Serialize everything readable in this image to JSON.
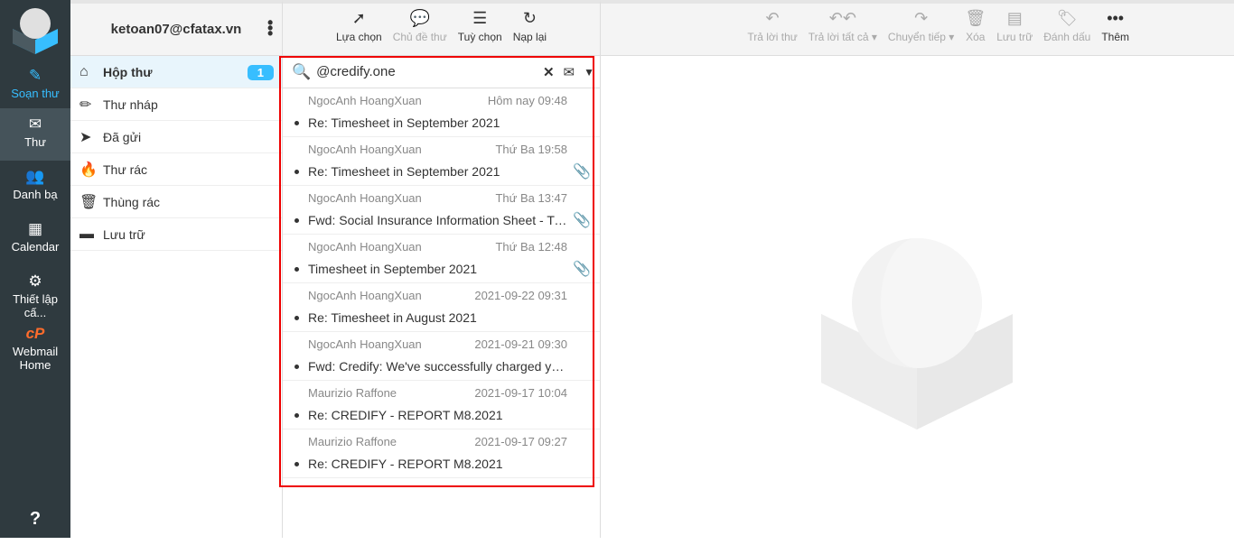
{
  "rail": {
    "items": [
      {
        "label": "Soạn thư",
        "icon": "compose-icon"
      },
      {
        "label": "Thư",
        "icon": "envelope-icon"
      },
      {
        "label": "Danh bạ",
        "icon": "contacts-icon"
      },
      {
        "label": "Calendar",
        "icon": "calendar-icon"
      },
      {
        "label": "Thiết lập cấ...",
        "icon": "gear-icon"
      },
      {
        "label": "Webmail Home",
        "icon": "cpanel-icon"
      }
    ],
    "help_icon": "help-icon"
  },
  "account": "ketoan07@cfatax.vn",
  "folders": [
    {
      "label": "Hộp thư",
      "count": "1"
    },
    {
      "label": "Thư nháp"
    },
    {
      "label": "Đã gửi"
    },
    {
      "label": "Thư rác"
    },
    {
      "label": "Thùng rác"
    },
    {
      "label": "Lưu trữ"
    }
  ],
  "list_toolbar": {
    "select": "Lựa chọn",
    "threads": "Chủ đề thư",
    "options": "Tuỳ chọn",
    "refresh": "Nạp lại"
  },
  "search": {
    "value": "@credify.one"
  },
  "messages": [
    {
      "from": "NgocAnh HoangXuan",
      "date": "Hôm nay 09:48",
      "subject": "Re: Timesheet in September 2021",
      "attachment": false
    },
    {
      "from": "NgocAnh HoangXuan",
      "date": "Thứ Ba 19:58",
      "subject": "Re: Timesheet in September 2021",
      "attachment": true
    },
    {
      "from": "NgocAnh HoangXuan",
      "date": "Thứ Ba 13:47",
      "subject": "Fwd: Social Insurance Information Sheet - Tran Thi",
      "attachment": true
    },
    {
      "from": "NgocAnh HoangXuan",
      "date": "Thứ Ba 12:48",
      "subject": "Timesheet in September 2021",
      "attachment": true
    },
    {
      "from": "NgocAnh HoangXuan",
      "date": "2021-09-22 09:31",
      "subject": "Re: Timesheet in August 2021",
      "attachment": false
    },
    {
      "from": "NgocAnh HoangXuan",
      "date": "2021-09-21 09:30",
      "subject": "Fwd: Credify: We've successfully charged your card",
      "attachment": false
    },
    {
      "from": "Maurizio Raffone",
      "date": "2021-09-17 10:04",
      "subject": "Re: CREDIFY - REPORT M8.2021",
      "attachment": false
    },
    {
      "from": "Maurizio Raffone",
      "date": "2021-09-17 09:27",
      "subject": "Re: CREDIFY - REPORT M8.2021",
      "attachment": false
    }
  ],
  "msg_toolbar": {
    "reply": "Trả lời thư",
    "reply_all": "Trả lời tất cả",
    "forward": "Chuyển tiếp",
    "delete": "Xóa",
    "archive": "Lưu trữ",
    "mark": "Đánh dấu",
    "more": "Thêm"
  }
}
